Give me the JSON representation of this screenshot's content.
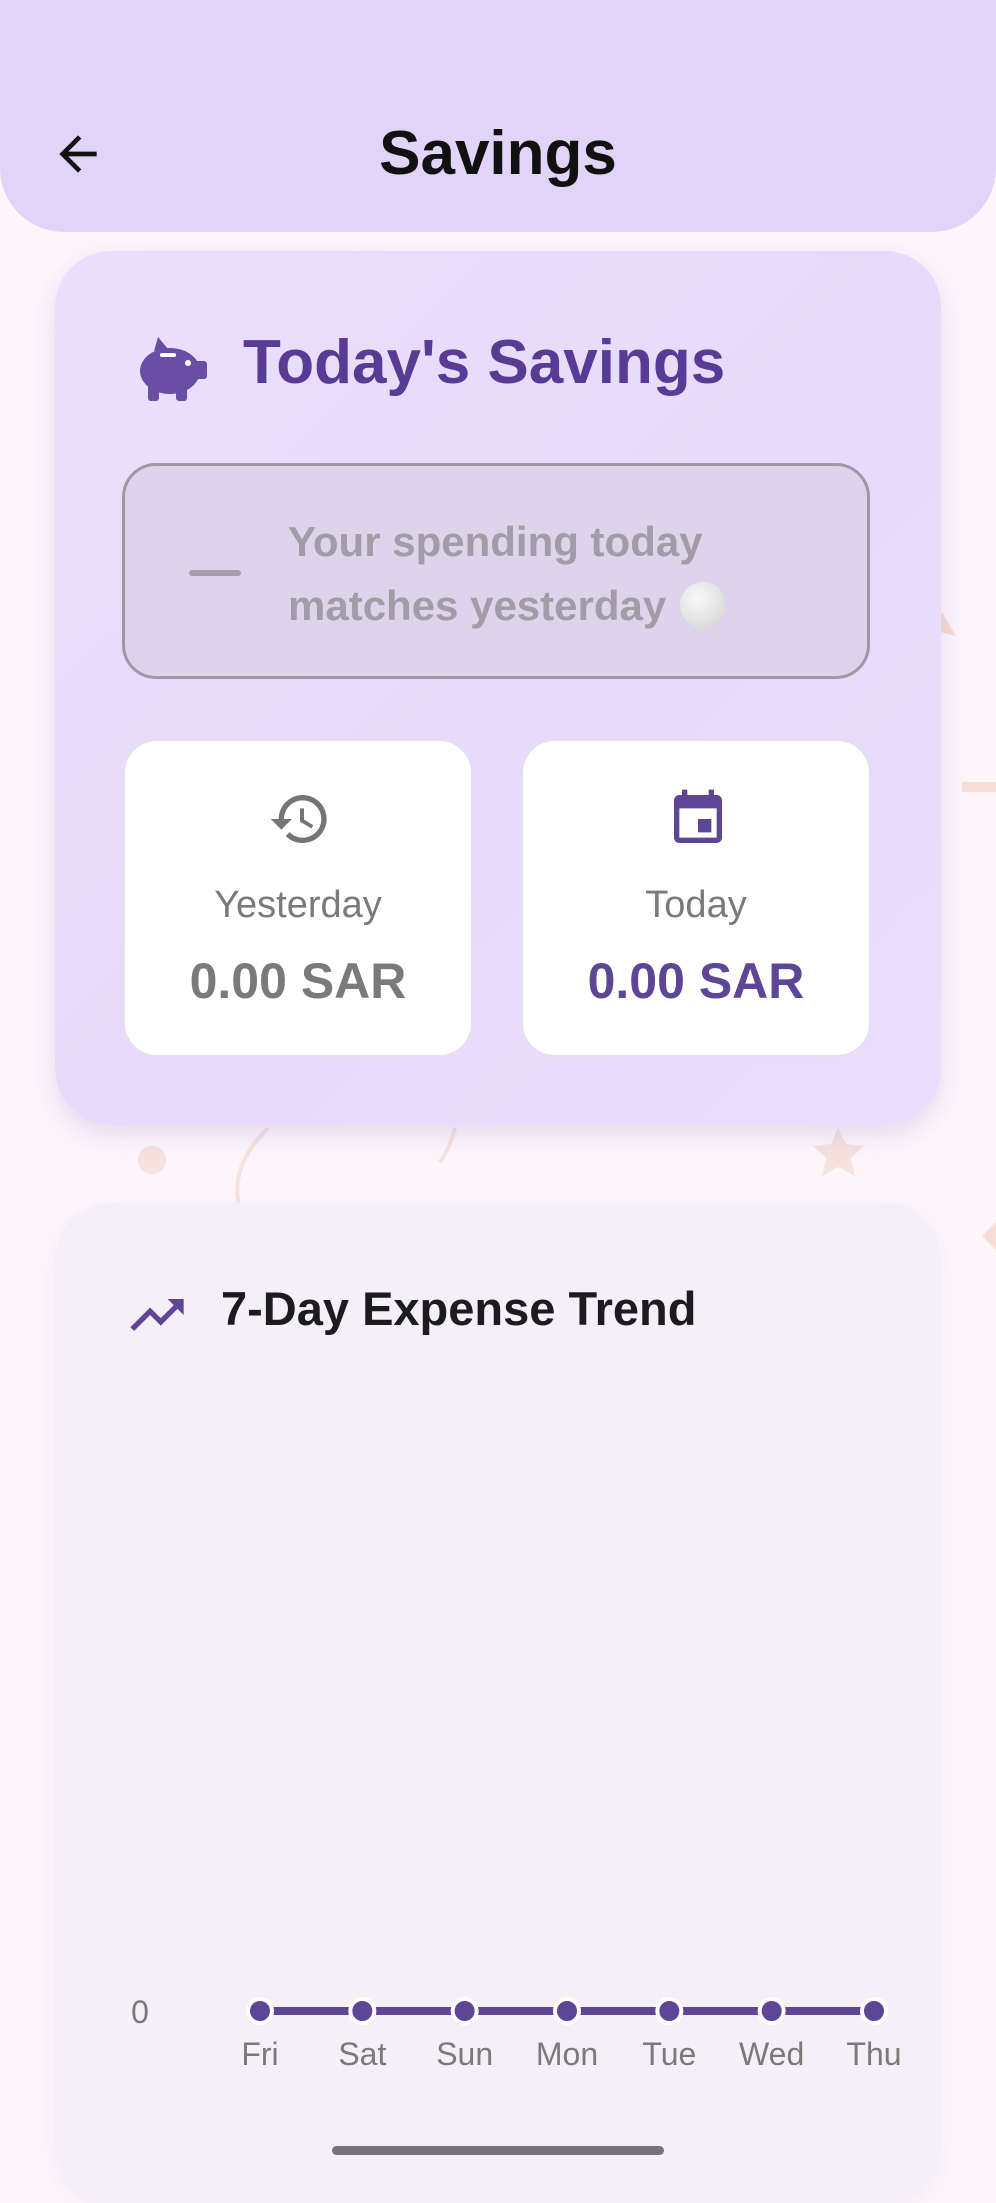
{
  "app_bar": {
    "title": "Savings",
    "back_icon": "arrow-left-icon"
  },
  "savings_card": {
    "icon": "piggy-bank-icon",
    "title": "Today's Savings",
    "status": {
      "icon": "minus-dash-icon",
      "message": "Your spending today matches yesterday",
      "emoji": "white-circle-emoji"
    },
    "yesterday": {
      "icon": "history-icon",
      "label": "Yesterday",
      "value": "0.00 SAR"
    },
    "today": {
      "icon": "calendar-icon",
      "label": "Today",
      "value": "0.00 SAR"
    }
  },
  "trend_card": {
    "icon": "trending-up-icon",
    "title": "7-Day Expense Trend"
  },
  "colors": {
    "app_bar": "#e1d4f9",
    "accent": "#5e4596",
    "card_title": "#573b95",
    "muted": "#7a7a7a",
    "background": "#fdf7fc"
  },
  "chart_data": {
    "type": "line",
    "x": [
      "Fri",
      "Sat",
      "Sun",
      "Mon",
      "Tue",
      "Wed",
      "Thu"
    ],
    "series": [
      {
        "values": [
          0,
          0,
          0,
          0,
          0,
          0,
          0
        ]
      }
    ],
    "y_tick_labels": [
      "0"
    ],
    "grid": false,
    "legend": "none"
  }
}
